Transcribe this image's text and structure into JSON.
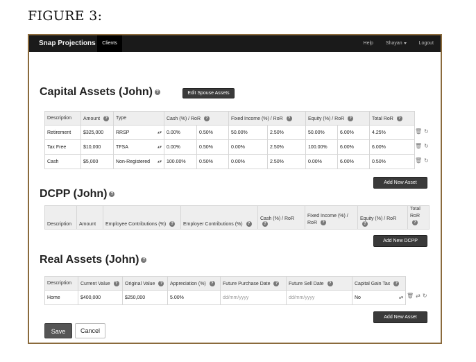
{
  "figure_caption": "FIGURE 3:",
  "nav": {
    "brand": "Snap Projections",
    "clients": "Clients",
    "help": "Help",
    "user": "Shayan",
    "logout": "Logout"
  },
  "capital": {
    "title": "Capital Assets (John)",
    "edit_spouse": "Edit Spouse Assets",
    "headers": [
      "Description",
      "Amount",
      "Type",
      "Cash (%) / RoR",
      "Fixed Income (%) / RoR",
      "Equity (%) / RoR",
      "Total RoR"
    ],
    "rows": [
      {
        "description": "Retirement",
        "amount": "$325,000",
        "type": "RRSP",
        "cash_pct": "0.00%",
        "cash_ror": "0.50%",
        "fi_pct": "50.00%",
        "fi_ror": "2.50%",
        "eq_pct": "50.00%",
        "eq_ror": "6.00%",
        "total": "4.25%"
      },
      {
        "description": "Tax Free",
        "amount": "$10,000",
        "type": "TFSA",
        "cash_pct": "0.00%",
        "cash_ror": "0.50%",
        "fi_pct": "0.00%",
        "fi_ror": "2.50%",
        "eq_pct": "100.00%",
        "eq_ror": "6.00%",
        "total": "6.00%"
      },
      {
        "description": "Cash",
        "amount": "$5,000",
        "type": "Non-Registered",
        "cash_pct": "100.00%",
        "cash_ror": "0.50%",
        "fi_pct": "0.00%",
        "fi_ror": "2.50%",
        "eq_pct": "0.00%",
        "eq_ror": "6.00%",
        "total": "0.50%"
      }
    ],
    "add_button": "Add New Asset"
  },
  "dcpp": {
    "title": "DCPP (John)",
    "headers": [
      "Description",
      "Amount",
      "Employee Contributions (%)",
      "Employer Contributions (%)",
      "Cash (%) / RoR",
      "Fixed Income (%) / RoR",
      "Equity (%) / RoR",
      "Total RoR"
    ],
    "add_button": "Add New DCPP"
  },
  "real": {
    "title": "Real Assets (John)",
    "headers": [
      "Description",
      "Current Value",
      "Original Value",
      "Appreciation (%)",
      "Future Purchase Date",
      "Future Sell Date",
      "Capital Gain Tax"
    ],
    "row": {
      "description": "Home",
      "current": "$400,000",
      "original": "$250,000",
      "appreciation": "5.00%",
      "purchase_placeholder": "dd/mm/yyyy",
      "sell_placeholder": "dd/mm/yyyy",
      "cgt": "No"
    },
    "add_button": "Add New Asset"
  },
  "footer": {
    "save": "Save",
    "cancel": "Cancel"
  }
}
